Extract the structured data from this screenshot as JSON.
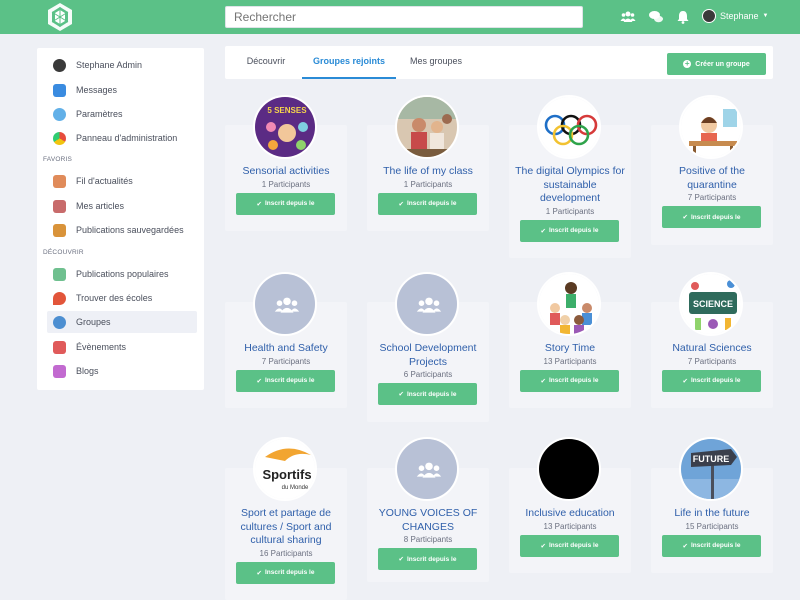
{
  "search": {
    "placeholder": "Rechercher"
  },
  "user": {
    "name": "Stephane"
  },
  "colors": {
    "brand": "#5bc187",
    "link": "#2f5faa",
    "tab_active": "#2a8bd6"
  },
  "sidebar": {
    "items": [
      {
        "label": "Stephane Admin",
        "icon": "user-avatar-icon"
      },
      {
        "label": "Messages",
        "icon": "chat-bubble-icon"
      },
      {
        "label": "Paramètres",
        "icon": "gears-icon"
      },
      {
        "label": "Panneau d'administration",
        "icon": "speedometer-icon"
      }
    ],
    "favoris_label": "FAVORIS",
    "favoris": [
      {
        "label": "Fil d'actualités",
        "icon": "newsfeed-icon"
      },
      {
        "label": "Mes articles",
        "icon": "articles-icon"
      },
      {
        "label": "Publications sauvegardées",
        "icon": "briefcase-icon"
      }
    ],
    "decouvrir_label": "DÉCOUVRIR",
    "decouvrir": [
      {
        "label": "Publications populaires",
        "icon": "grid-icon"
      },
      {
        "label": "Trouver des écoles",
        "icon": "map-pin-icon"
      },
      {
        "label": "Groupes",
        "icon": "globe-group-icon"
      },
      {
        "label": "Évènements",
        "icon": "calendar-icon"
      },
      {
        "label": "Blogs",
        "icon": "notepad-icon"
      }
    ]
  },
  "tabs": [
    {
      "label": "Découvrir"
    },
    {
      "label": "Groupes rejoints"
    },
    {
      "label": "Mes groupes"
    }
  ],
  "create_button": "Créer un groupe",
  "joined_label": "Inscrit depuis le",
  "groups": [
    {
      "title": "Sensorial activities",
      "count": "1 Participants",
      "image": "sensorial-5-senses"
    },
    {
      "title": "The life of my class",
      "count": "1 Participants",
      "image": "classroom-photo"
    },
    {
      "title": "The digital Olympics for sustainable development",
      "count": "1 Participants",
      "image": "olympic-rings"
    },
    {
      "title": "Positive of the quarantine",
      "count": "7 Participants",
      "image": "child-at-desk"
    },
    {
      "title": "Health and Safety",
      "count": "7 Participants",
      "image": "group-placeholder"
    },
    {
      "title": "School Development Projects",
      "count": "6 Participants",
      "image": "group-placeholder"
    },
    {
      "title": "Story Time",
      "count": "13 Participants",
      "image": "kids-reading"
    },
    {
      "title": "Natural Sciences",
      "count": "7 Participants",
      "image": "science-board"
    },
    {
      "title": "Sport et partage de cultures / Sport and cultural sharing",
      "count": "16 Participants",
      "image": "sportifs-du-monde-logo"
    },
    {
      "title": "YOUNG VOICES OF CHANGES",
      "count": "8 Participants",
      "image": "group-placeholder"
    },
    {
      "title": "Inclusive education",
      "count": "13 Participants",
      "image": "black-circle"
    },
    {
      "title": "Life in the future",
      "count": "15 Participants",
      "image": "future-sign"
    }
  ],
  "logo_text": {
    "sportifs": "Sportifs",
    "du_monde": "du Monde"
  },
  "future_sign_text": "FUTURE",
  "senses_text": "5 SENSES",
  "science_text": "SCIENCE"
}
